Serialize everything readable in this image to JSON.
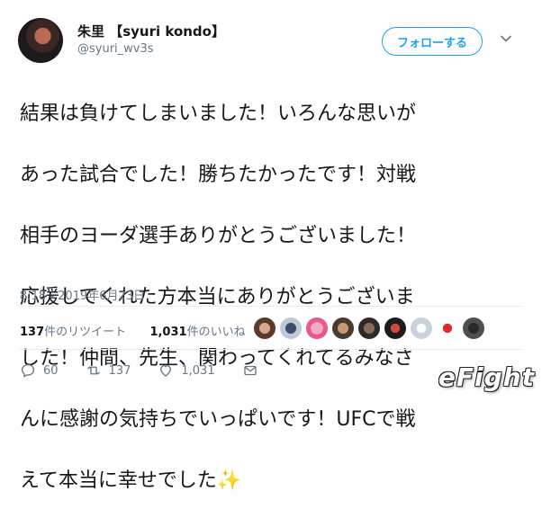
{
  "header": {
    "display_name": "朱里 【syuri kondo】",
    "handle": "@syuri_wv3s",
    "follow_label": "フォローする"
  },
  "tweet": {
    "lines": [
      "結果は負けてしまいました！いろんな思いが",
      "あった試合でした！勝ちたかったです！対戦",
      "相手のヨーダ選手ありがとうございました！",
      "応援してくれた方本当にありがとうございま",
      "した！仲間、先生、関わってくれてるみなさ",
      "んに感謝の気持ちでいっぱいです！UFCで戦",
      "えて本当に幸せでした✨"
    ],
    "timestamp": "8:18 - 2019年6月23日"
  },
  "stats": {
    "retweets_count": "137",
    "retweets_suffix": "件のリツイート",
    "likes_count": "1,031",
    "likes_suffix": "件のいいね"
  },
  "actions": {
    "reply_count": "60",
    "retweet_count": "137",
    "like_count": "1,031"
  },
  "watermark": {
    "text": "eFight"
  },
  "colors": {
    "accent": "#1da1f2",
    "text": "#14171a",
    "muted": "#657786",
    "divider": "#e6ecf0"
  }
}
